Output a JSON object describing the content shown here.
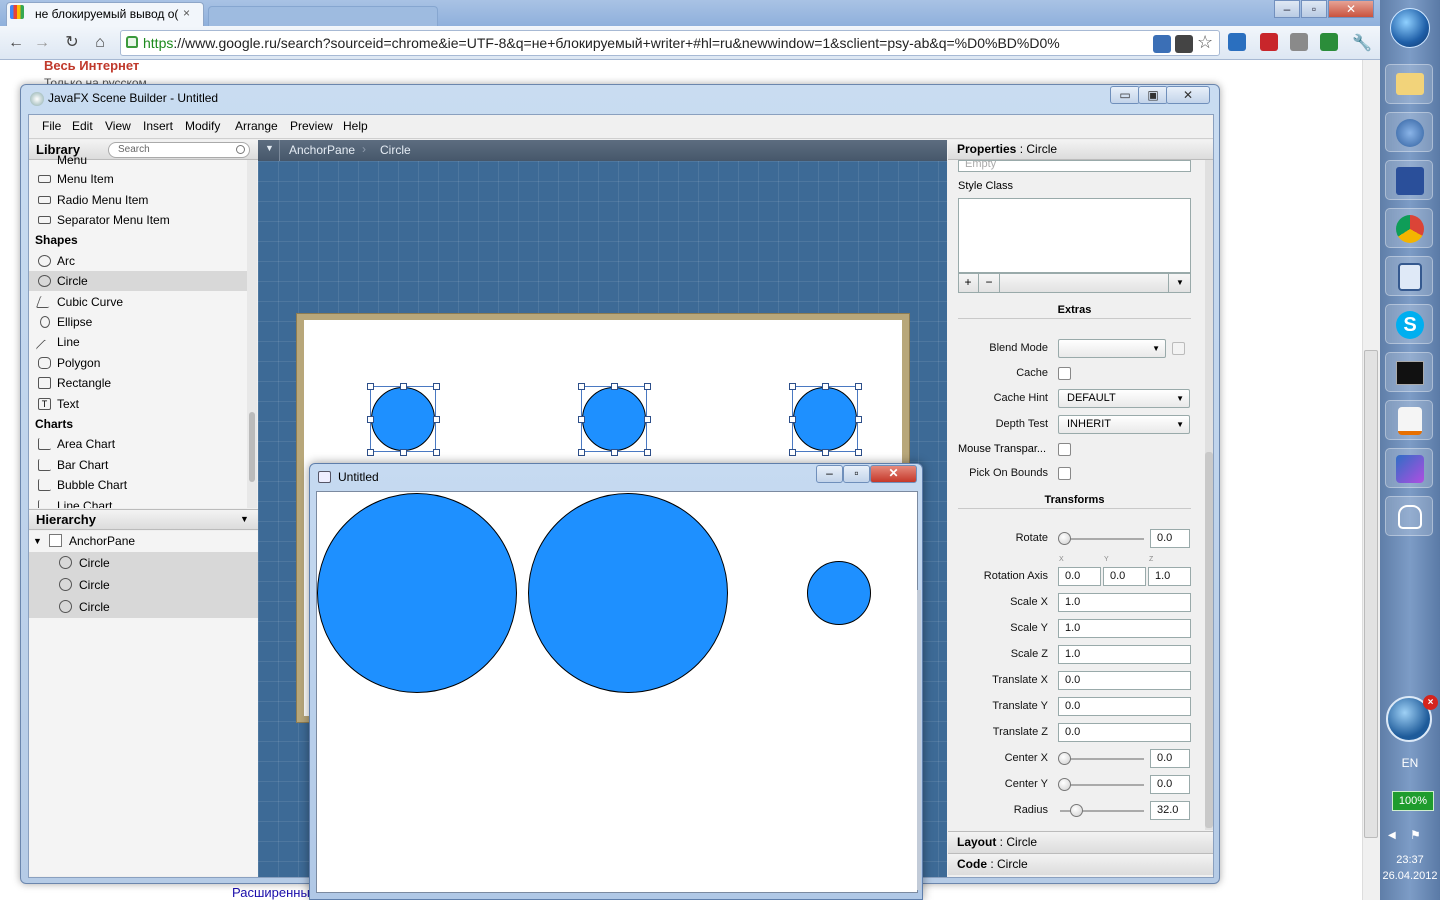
{
  "browser": {
    "tab_title": "не блокируемый вывод о(",
    "tab_close": "×",
    "window_controls": {
      "minimize": "–",
      "restore": "▫",
      "close": "✕"
    },
    "url_scheme": "https",
    "url_rest": "://www.google.ru/search?sourceid=chrome&ie=UTF-8&q=не+блокируемый+writer+#hl=ru&newwindow=1&sclient=psy-ab&q=%D0%BD%D0%",
    "nav_icons": [
      "back-icon",
      "forward-icon",
      "reload-icon",
      "home-icon"
    ]
  },
  "google_page": {
    "all_internet": "Весь Интернет",
    "russian_only": "Только на русском",
    "advanced": "Расширенный"
  },
  "scene_builder": {
    "title": "JavaFX Scene Builder - Untitled",
    "controls": {
      "minimize": "▭",
      "restore": "▣",
      "close": "✕"
    },
    "menus": [
      "File",
      "Edit",
      "View",
      "Insert",
      "Modify",
      "Arrange",
      "Preview",
      "Help"
    ],
    "library": {
      "title": "Library",
      "search_placeholder": "Search",
      "partial_top": "Menu",
      "items_top": [
        "Menu Item",
        "Radio Menu Item",
        "Separator Menu Item"
      ],
      "shapes_label": "Shapes",
      "shapes": [
        "Arc",
        "Circle",
        "Cubic Curve",
        "Ellipse",
        "Line",
        "Polygon",
        "Rectangle",
        "Text"
      ],
      "selected": "Circle",
      "charts_label": "Charts",
      "charts": [
        "Area Chart",
        "Bar Chart",
        "Bubble Chart"
      ],
      "partial_bottom": "Line Chart"
    },
    "hierarchy": {
      "title": "Hierarchy",
      "root": "AnchorPane",
      "children": [
        "Circle",
        "Circle",
        "Circle"
      ]
    },
    "breadcrumb": [
      "AnchorPane",
      "Circle"
    ],
    "properties": {
      "header_label": "Properties",
      "header_target": "Circle",
      "empty_hint": "Empty",
      "style_class_label": "Style Class",
      "add": "+",
      "remove": "−",
      "extras_label": "Extras",
      "blend_mode_label": "Blend Mode",
      "blend_mode_value": "",
      "cache_label": "Cache",
      "cache_hint_label": "Cache Hint",
      "cache_hint_value": "DEFAULT",
      "depth_test_label": "Depth Test",
      "depth_test_value": "INHERIT",
      "mouse_transparent_label": "Mouse Transpar...",
      "pick_on_bounds_label": "Pick On Bounds",
      "transforms_label": "Transforms",
      "rotate_label": "Rotate",
      "rotate_value": "0.0",
      "rotation_axis_label": "Rotation Axis",
      "axis_labels": [
        "X",
        "Y",
        "Z"
      ],
      "rotation_axis_x": "0.0",
      "rotation_axis_y": "0.0",
      "rotation_axis_z": "1.0",
      "scale_x_label": "Scale X",
      "scale_x": "1.0",
      "scale_y_label": "Scale Y",
      "scale_y": "1.0",
      "scale_z_label": "Scale Z",
      "scale_z": "1.0",
      "translate_x_label": "Translate X",
      "translate_x": "0.0",
      "translate_y_label": "Translate Y",
      "translate_y": "0.0",
      "translate_z_label": "Translate Z",
      "translate_z": "0.0",
      "center_x_label": "Center X",
      "center_x": "0.0",
      "center_y_label": "Center Y",
      "center_y": "0.0",
      "radius_label": "Radius",
      "radius": "32.0"
    },
    "layout_label": "Layout",
    "layout_target": "Circle",
    "code_label": "Code",
    "code_target": "Circle"
  },
  "preview": {
    "title": "Untitled",
    "controls": {
      "minimize": "–",
      "restore": "▫",
      "close": "✕"
    }
  },
  "colors": {
    "circle_fill": "#1e90ff",
    "canvas": "#3d6a96"
  },
  "taskbar": {
    "language": "EN",
    "battery": "100%",
    "time": "23:37",
    "date": "26.04.2012"
  }
}
